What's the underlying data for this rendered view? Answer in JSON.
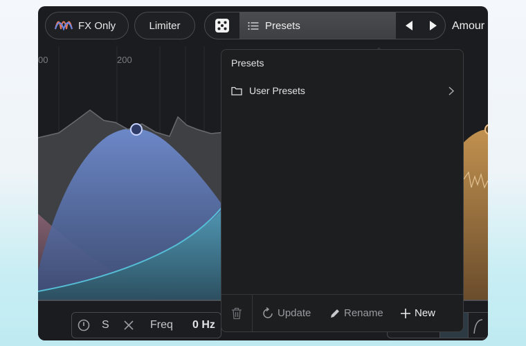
{
  "toolbar": {
    "fx_only_label": "FX Only",
    "limiter_label": "Limiter",
    "preset_name": "Presets",
    "amount_label": "Amour",
    "icons": {
      "fx": "fx-waveform-icon",
      "dice": "dice-icon",
      "list": "list-icon",
      "prev": "triangle-left-icon",
      "next": "triangle-right-icon"
    }
  },
  "graph": {
    "freq_ticks": [
      "00",
      "200"
    ]
  },
  "dropdown": {
    "header": "Presets",
    "items": [
      {
        "label": "User Presets",
        "icon": "folder-icon",
        "chevron": "chevron-right-icon"
      }
    ],
    "footer": {
      "delete_icon": "trash-icon",
      "update_label": "Update",
      "rename_label": "Rename",
      "new_label": "New"
    }
  },
  "bottom": {
    "solo_label": "S",
    "freq_label": "Freq",
    "freq_value": "0 Hz"
  },
  "colors": {
    "bg": "#1b1c1f",
    "blue_band": "#6b87c9",
    "orange_band": "#b88a4e",
    "teal_curve": "#4fb6cf",
    "text_muted": "#9a9ba0"
  }
}
